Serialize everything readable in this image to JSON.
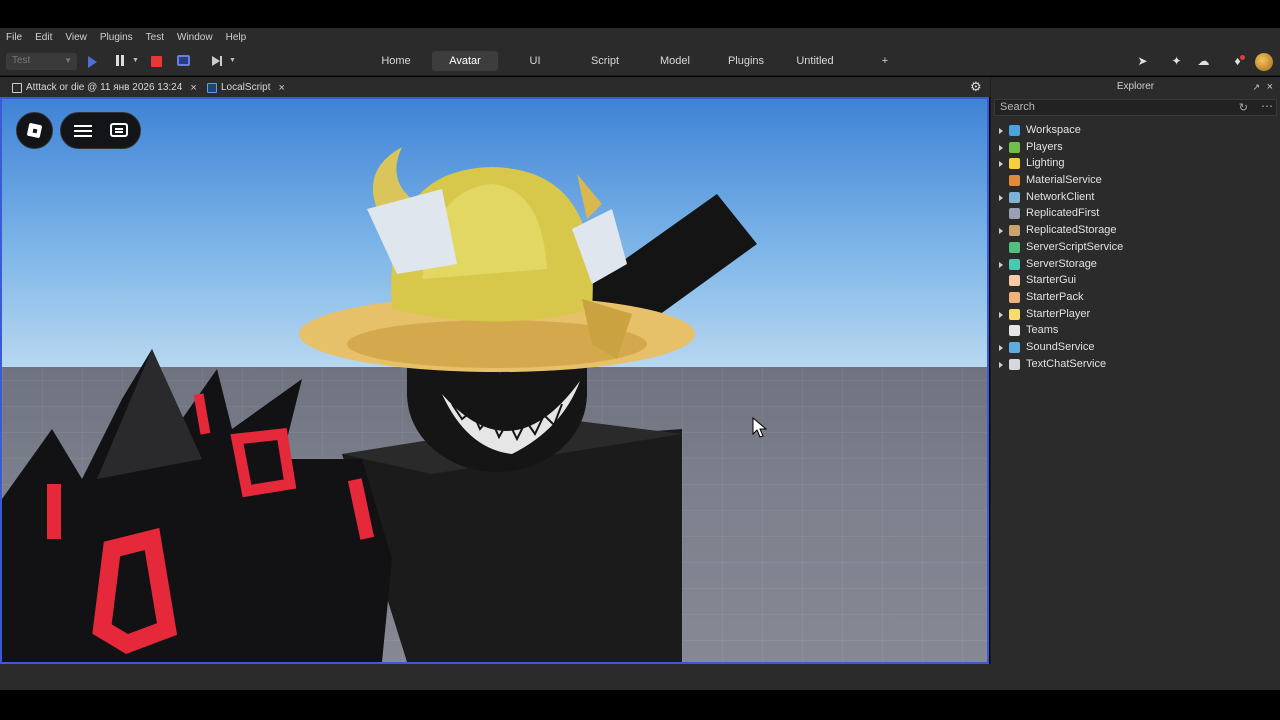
{
  "menu": [
    "File",
    "Edit",
    "View",
    "Plugins",
    "Test",
    "Window",
    "Help"
  ],
  "toolbar": {
    "test_select": "Test",
    "tabs": [
      "Home",
      "Avatar",
      "UI",
      "Script",
      "Model",
      "Plugins",
      "Untitled"
    ],
    "active_tab": "Avatar",
    "add_tab": "+"
  },
  "doc_tabs": [
    {
      "label": "Atttack or die @ 11 янв 2026 13:24",
      "close": "×"
    },
    {
      "label": "LocalScript",
      "close": "×"
    }
  ],
  "explorer": {
    "title": "Explorer",
    "search_placeholder": "Search",
    "items": [
      {
        "name": "Workspace",
        "expandable": true,
        "icon_color": "#4aa3df"
      },
      {
        "name": "Players",
        "expandable": true,
        "icon_color": "#6fbf4a"
      },
      {
        "name": "Lighting",
        "expandable": true,
        "icon_color": "#f4d03f"
      },
      {
        "name": "MaterialService",
        "expandable": false,
        "icon_color": "#e08a3c"
      },
      {
        "name": "NetworkClient",
        "expandable": true,
        "icon_color": "#7fb3d5"
      },
      {
        "name": "ReplicatedFirst",
        "expandable": false,
        "icon_color": "#9aa0b4"
      },
      {
        "name": "ReplicatedStorage",
        "expandable": true,
        "icon_color": "#c9a36b"
      },
      {
        "name": "ServerScriptService",
        "expandable": false,
        "icon_color": "#52be80"
      },
      {
        "name": "ServerStorage",
        "expandable": true,
        "icon_color": "#48c9b0"
      },
      {
        "name": "StarterGui",
        "expandable": false,
        "icon_color": "#f5cba7"
      },
      {
        "name": "StarterPack",
        "expandable": false,
        "icon_color": "#f0b27a"
      },
      {
        "name": "StarterPlayer",
        "expandable": true,
        "icon_color": "#f7dc6f"
      },
      {
        "name": "Teams",
        "expandable": false,
        "icon_color": "#e6e6e6"
      },
      {
        "name": "SoundService",
        "expandable": true,
        "icon_color": "#5dade2"
      },
      {
        "name": "TextChatService",
        "expandable": true,
        "icon_color": "#d5d8dc"
      }
    ]
  },
  "colors": {
    "accent": "#3b5bd6",
    "stop": "#e53935",
    "play": "#4c6ed9"
  }
}
